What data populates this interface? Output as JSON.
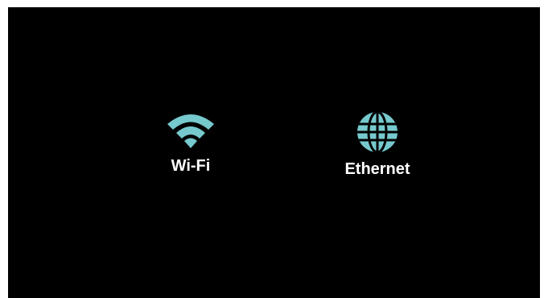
{
  "colors": {
    "background": "#000000",
    "icon": "#76C9CD",
    "label": "#FFFFFF"
  },
  "options": [
    {
      "label": "Wi-Fi",
      "icon": "wifi-icon"
    },
    {
      "label": "Ethernet",
      "icon": "globe-icon"
    }
  ]
}
